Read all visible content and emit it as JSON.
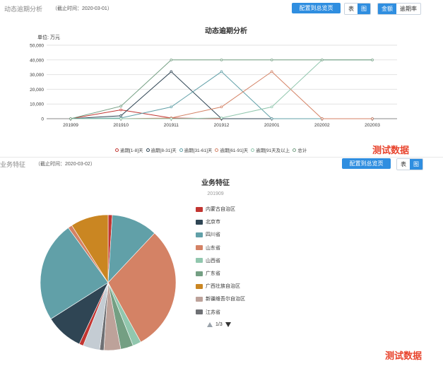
{
  "panel1": {
    "title": "动态逾期分析",
    "time": "（截止时间：2020-03-01）",
    "config_btn": "配置到总览页",
    "view_toggle": [
      "表",
      "图"
    ],
    "metric_toggle": [
      "金额",
      "逾期率"
    ]
  },
  "panel2": {
    "title": "业务特征",
    "time": "（截止时间：2020-03-02）",
    "config_btn": "配置到总览页",
    "view_toggle": [
      "表",
      "图"
    ]
  },
  "watermarks": [
    "测试数据",
    "测试数据"
  ],
  "pager": {
    "text": "1/3"
  },
  "colors": {
    "accent": "#2f8ee0",
    "watermark": "#e8432c"
  },
  "chart_data": [
    {
      "type": "line",
      "title": "动态逾期分析",
      "ylabel": "单位: 万元",
      "x": [
        "201909",
        "201910",
        "201911",
        "201912",
        "202001",
        "202002",
        "202003"
      ],
      "ylim": [
        0,
        50000
      ],
      "yticks": [
        "0",
        "10,000",
        "20,000",
        "30,000",
        "40,000",
        "50,000"
      ],
      "grid": true,
      "legend_position": "bottom",
      "series": [
        {
          "name": "逾期[1-8]天",
          "color": "#c23531",
          "values": [
            0,
            6000,
            500,
            0,
            0,
            0,
            0
          ]
        },
        {
          "name": "逾期[8-31]天",
          "color": "#2f4554",
          "values": [
            0,
            2000,
            32000,
            0,
            0,
            0,
            0
          ]
        },
        {
          "name": "逾期[31-61]天",
          "color": "#61a0a8",
          "values": [
            0,
            500,
            8000,
            32000,
            0,
            0,
            0
          ]
        },
        {
          "name": "逾期[61-91]天",
          "color": "#d48265",
          "values": [
            0,
            0,
            500,
            8000,
            32000,
            0,
            0
          ]
        },
        {
          "name": "逾期[91天及以上",
          "color": "#91c7ae",
          "values": [
            0,
            0,
            0,
            500,
            8000,
            40000,
            40000
          ]
        },
        {
          "name": "总计",
          "color": "#749f83",
          "values": [
            0,
            8500,
            40000,
            40000,
            40000,
            40000,
            40000
          ]
        }
      ]
    },
    {
      "type": "pie",
      "title": "业务特征",
      "subtitle": "201909",
      "legend_position": "right",
      "legend_page": "1/3",
      "slices": [
        {
          "name": "内蒙古自治区",
          "color": "#c23531",
          "value": 1
        },
        {
          "name": "北京市",
          "color": "#2f4554",
          "value": 0
        },
        {
          "name": "四川省",
          "color": "#61a0a8",
          "value": 11
        },
        {
          "name": "山东省",
          "color": "#d48265",
          "value": 30
        },
        {
          "name": "山西省",
          "color": "#91c7ae",
          "value": 2
        },
        {
          "name": "广东省",
          "color": "#749f83",
          "value": 3
        },
        {
          "name": "广西壮族自治区",
          "color": "#ca8622",
          "value": 0
        },
        {
          "name": "新疆维吾尔自治区",
          "color": "#bda29a",
          "value": 4
        },
        {
          "name": "江苏省",
          "color": "#6e7074",
          "value": 1
        },
        {
          "name": "",
          "color": "#c4ccd3",
          "value": 4
        },
        {
          "name": "",
          "color": "#c23531",
          "value": 1
        },
        {
          "name": "",
          "color": "#2f4554",
          "value": 9
        },
        {
          "name": "",
          "color": "#61a0a8",
          "value": 24
        },
        {
          "name": "",
          "color": "#d48265",
          "value": 1
        },
        {
          "name": "",
          "color": "#ca8622",
          "value": 9
        }
      ]
    }
  ]
}
